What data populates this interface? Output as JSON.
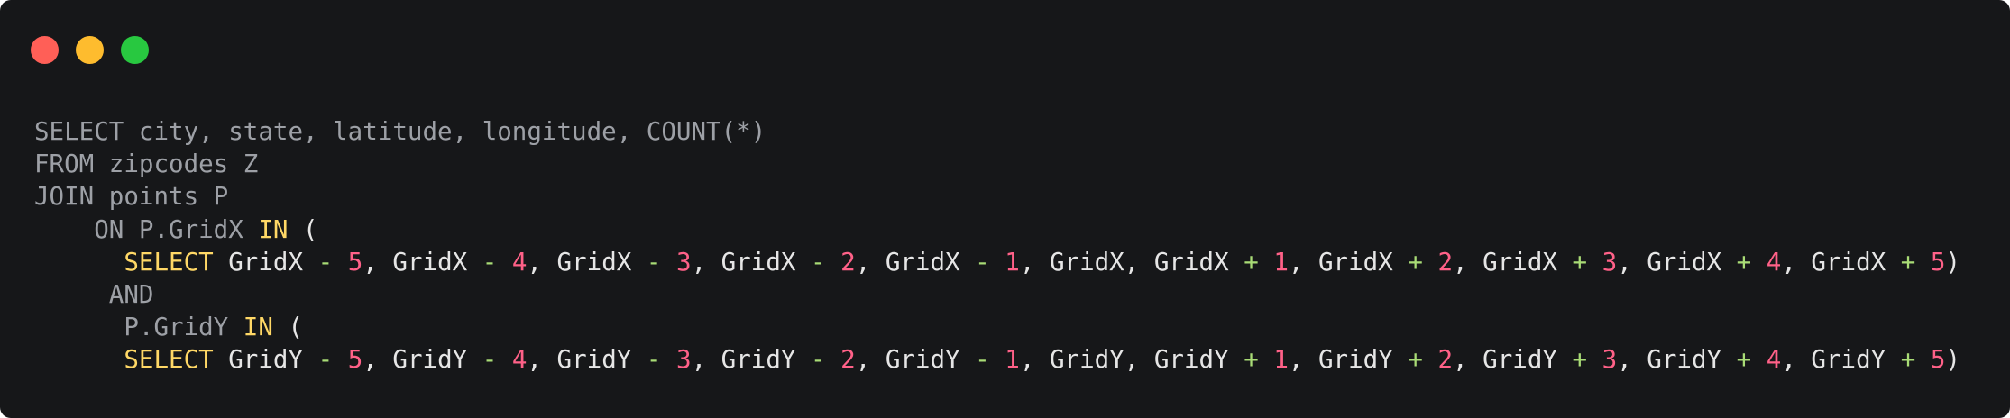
{
  "window": {
    "controls": [
      {
        "name": "close",
        "color": "#ff5f57"
      },
      {
        "name": "minimize",
        "color": "#febc2e"
      },
      {
        "name": "maximize",
        "color": "#28c840"
      }
    ]
  },
  "colors": {
    "background": "#161719",
    "plain": "#9da0a6",
    "ident": "#e6e6e6",
    "keyword": "#ffd866",
    "operator": "#a9dc76",
    "number": "#ff6188"
  },
  "code": {
    "lines": [
      [
        {
          "t": "SELECT city, state, latitude, longitude, COUNT(*)",
          "k": "plain"
        }
      ],
      [
        {
          "t": "FROM zipcodes Z",
          "k": "plain"
        }
      ],
      [
        {
          "t": "JOIN points P",
          "k": "plain"
        }
      ],
      [
        {
          "t": "    ON P.GridX ",
          "k": "plain"
        },
        {
          "t": "IN",
          "k": "keyword"
        },
        {
          "t": " (",
          "k": "ident"
        }
      ],
      [
        {
          "t": "      ",
          "k": "plain"
        },
        {
          "t": "SELECT",
          "k": "keyword"
        },
        {
          "t": " GridX ",
          "k": "ident"
        },
        {
          "t": "-",
          "k": "operator"
        },
        {
          "t": " ",
          "k": "ident"
        },
        {
          "t": "5",
          "k": "number"
        },
        {
          "t": ", GridX ",
          "k": "ident"
        },
        {
          "t": "-",
          "k": "operator"
        },
        {
          "t": " ",
          "k": "ident"
        },
        {
          "t": "4",
          "k": "number"
        },
        {
          "t": ", GridX ",
          "k": "ident"
        },
        {
          "t": "-",
          "k": "operator"
        },
        {
          "t": " ",
          "k": "ident"
        },
        {
          "t": "3",
          "k": "number"
        },
        {
          "t": ", GridX ",
          "k": "ident"
        },
        {
          "t": "-",
          "k": "operator"
        },
        {
          "t": " ",
          "k": "ident"
        },
        {
          "t": "2",
          "k": "number"
        },
        {
          "t": ", GridX ",
          "k": "ident"
        },
        {
          "t": "-",
          "k": "operator"
        },
        {
          "t": " ",
          "k": "ident"
        },
        {
          "t": "1",
          "k": "number"
        },
        {
          "t": ", GridX, GridX ",
          "k": "ident"
        },
        {
          "t": "+",
          "k": "operator"
        },
        {
          "t": " ",
          "k": "ident"
        },
        {
          "t": "1",
          "k": "number"
        },
        {
          "t": ", GridX ",
          "k": "ident"
        },
        {
          "t": "+",
          "k": "operator"
        },
        {
          "t": " ",
          "k": "ident"
        },
        {
          "t": "2",
          "k": "number"
        },
        {
          "t": ", GridX ",
          "k": "ident"
        },
        {
          "t": "+",
          "k": "operator"
        },
        {
          "t": " ",
          "k": "ident"
        },
        {
          "t": "3",
          "k": "number"
        },
        {
          "t": ", GridX ",
          "k": "ident"
        },
        {
          "t": "+",
          "k": "operator"
        },
        {
          "t": " ",
          "k": "ident"
        },
        {
          "t": "4",
          "k": "number"
        },
        {
          "t": ", GridX ",
          "k": "ident"
        },
        {
          "t": "+",
          "k": "operator"
        },
        {
          "t": " ",
          "k": "ident"
        },
        {
          "t": "5",
          "k": "number"
        },
        {
          "t": ")",
          "k": "ident"
        }
      ],
      [
        {
          "t": "     AND",
          "k": "plain"
        }
      ],
      [
        {
          "t": "      P.GridY ",
          "k": "plain"
        },
        {
          "t": "IN",
          "k": "keyword"
        },
        {
          "t": " (",
          "k": "ident"
        }
      ],
      [
        {
          "t": "      ",
          "k": "plain"
        },
        {
          "t": "SELECT",
          "k": "keyword"
        },
        {
          "t": " GridY ",
          "k": "ident"
        },
        {
          "t": "-",
          "k": "operator"
        },
        {
          "t": " ",
          "k": "ident"
        },
        {
          "t": "5",
          "k": "number"
        },
        {
          "t": ", GridY ",
          "k": "ident"
        },
        {
          "t": "-",
          "k": "operator"
        },
        {
          "t": " ",
          "k": "ident"
        },
        {
          "t": "4",
          "k": "number"
        },
        {
          "t": ", GridY ",
          "k": "ident"
        },
        {
          "t": "-",
          "k": "operator"
        },
        {
          "t": " ",
          "k": "ident"
        },
        {
          "t": "3",
          "k": "number"
        },
        {
          "t": ", GridY ",
          "k": "ident"
        },
        {
          "t": "-",
          "k": "operator"
        },
        {
          "t": " ",
          "k": "ident"
        },
        {
          "t": "2",
          "k": "number"
        },
        {
          "t": ", GridY ",
          "k": "ident"
        },
        {
          "t": "-",
          "k": "operator"
        },
        {
          "t": " ",
          "k": "ident"
        },
        {
          "t": "1",
          "k": "number"
        },
        {
          "t": ", GridY, GridY ",
          "k": "ident"
        },
        {
          "t": "+",
          "k": "operator"
        },
        {
          "t": " ",
          "k": "ident"
        },
        {
          "t": "1",
          "k": "number"
        },
        {
          "t": ", GridY ",
          "k": "ident"
        },
        {
          "t": "+",
          "k": "operator"
        },
        {
          "t": " ",
          "k": "ident"
        },
        {
          "t": "2",
          "k": "number"
        },
        {
          "t": ", GridY ",
          "k": "ident"
        },
        {
          "t": "+",
          "k": "operator"
        },
        {
          "t": " ",
          "k": "ident"
        },
        {
          "t": "3",
          "k": "number"
        },
        {
          "t": ", GridY ",
          "k": "ident"
        },
        {
          "t": "+",
          "k": "operator"
        },
        {
          "t": " ",
          "k": "ident"
        },
        {
          "t": "4",
          "k": "number"
        },
        {
          "t": ", GridY ",
          "k": "ident"
        },
        {
          "t": "+",
          "k": "operator"
        },
        {
          "t": " ",
          "k": "ident"
        },
        {
          "t": "5",
          "k": "number"
        },
        {
          "t": ")",
          "k": "ident"
        }
      ]
    ]
  }
}
